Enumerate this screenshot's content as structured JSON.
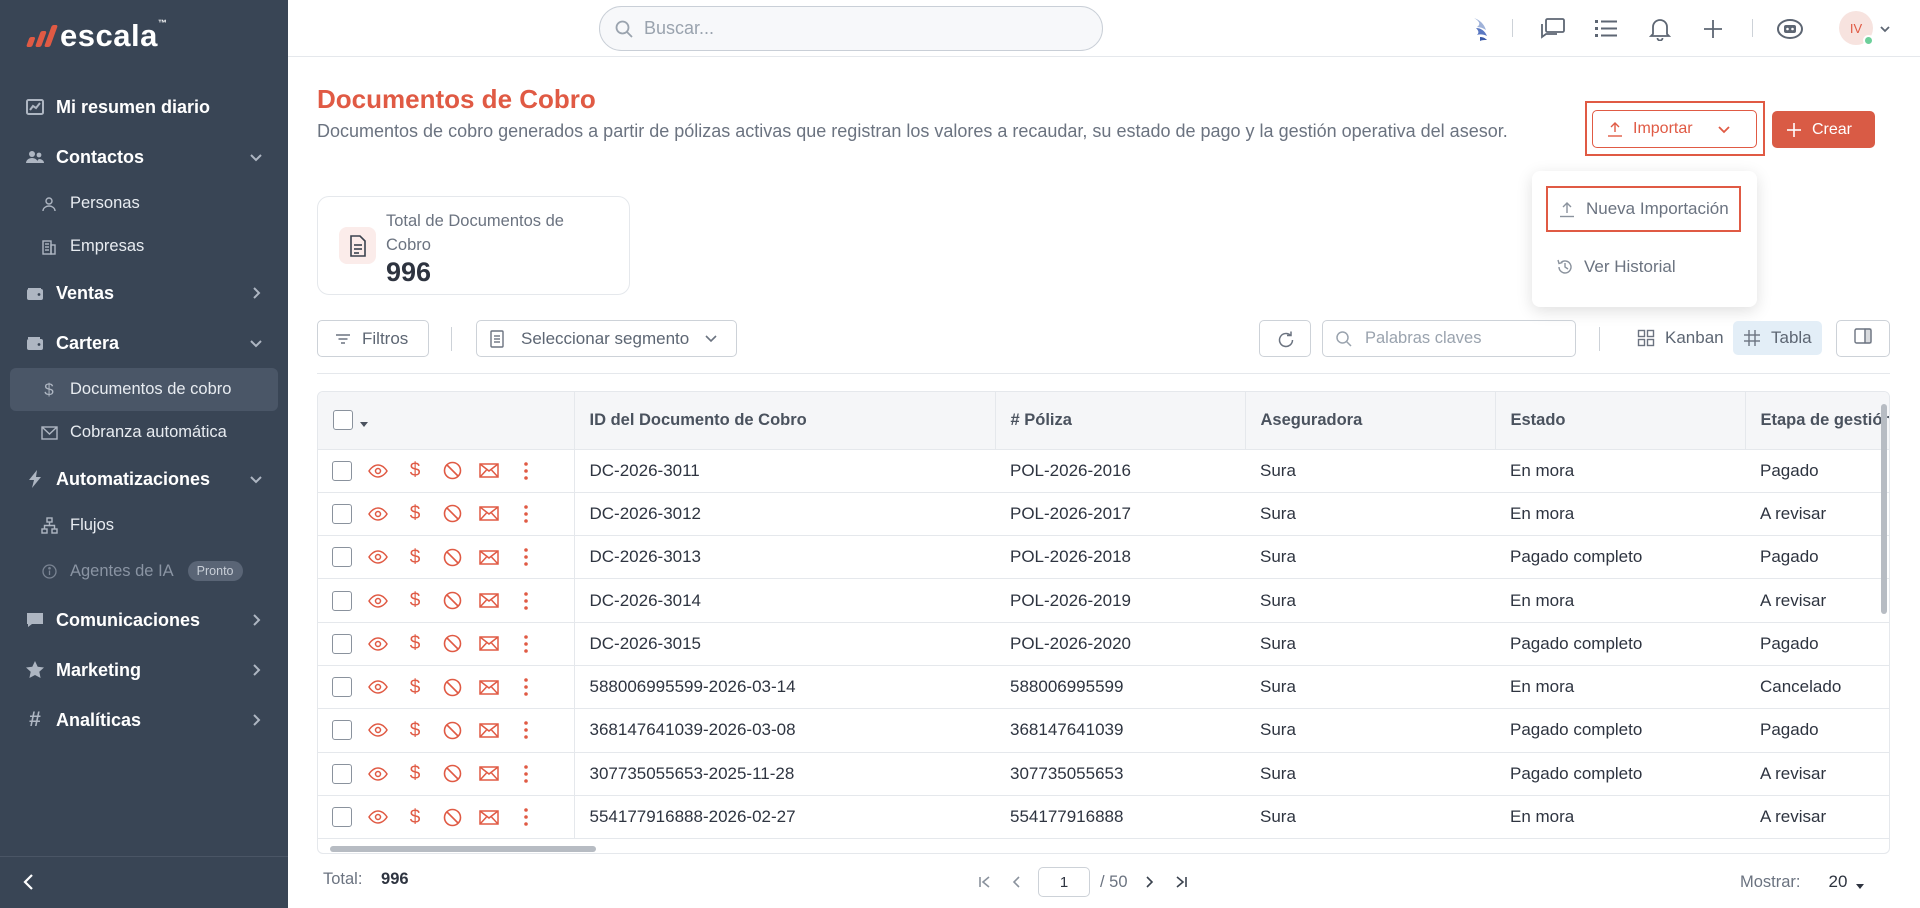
{
  "app": {
    "logo_text": "escala"
  },
  "sidebar": {
    "items": [
      {
        "label": "Mi resumen diario",
        "icon": "chart-icon"
      },
      {
        "label": "Contactos",
        "icon": "users-icon",
        "expanded": true,
        "children": [
          {
            "label": "Personas",
            "icon": "person-icon"
          },
          {
            "label": "Empresas",
            "icon": "building-icon"
          }
        ]
      },
      {
        "label": "Ventas",
        "icon": "wallet-icon",
        "expanded": false
      },
      {
        "label": "Cartera",
        "icon": "wallet-icon",
        "expanded": true,
        "children": [
          {
            "label": "Documentos de cobro",
            "icon": "dollar-icon",
            "active": true
          },
          {
            "label": "Cobranza automática",
            "icon": "mail-icon"
          }
        ]
      },
      {
        "label": "Automatizaciones",
        "icon": "bolt-icon",
        "expanded": true,
        "children": [
          {
            "label": "Flujos",
            "icon": "flow-icon"
          },
          {
            "label": "Agentes de IA",
            "icon": "info-icon",
            "badge": "Pronto",
            "disabled": true
          }
        ]
      },
      {
        "label": "Comunicaciones",
        "icon": "chat-icon",
        "expanded": false
      },
      {
        "label": "Marketing",
        "icon": "star-icon",
        "expanded": false
      },
      {
        "label": "Analíticas",
        "icon": "hash-icon",
        "expanded": false
      }
    ]
  },
  "topbar": {
    "search_placeholder": "Buscar...",
    "avatar_initials": "IV"
  },
  "page": {
    "title": "Documentos de Cobro",
    "description": "Documentos de cobro generados a partir de pólizas activas que registran los valores a recaudar, su estado de pago y la gestión operativa del asesor.",
    "import_label": "Importar",
    "create_label": "Crear",
    "dropdown": {
      "new_import": "Nueva Importación",
      "history": "Ver Historial"
    },
    "kpi": {
      "label": "Total de Documentos de Cobro",
      "value": "996"
    }
  },
  "toolbar": {
    "filters_label": "Filtros",
    "segment_label": "Seleccionar segmento",
    "keywords_placeholder": "Palabras claves",
    "kanban_label": "Kanban",
    "table_label": "Tabla",
    "active_view": "Tabla"
  },
  "table": {
    "columns": [
      "ID del Documento de Cobro",
      "# Póliza",
      "Aseguradora",
      "Estado",
      "Etapa de gestión"
    ],
    "rows": [
      [
        "DC-2026-3011",
        "POL-2026-2016",
        "Sura",
        "En mora",
        "Pagado"
      ],
      [
        "DC-2026-3012",
        "POL-2026-2017",
        "Sura",
        "En mora",
        "A revisar"
      ],
      [
        "DC-2026-3013",
        "POL-2026-2018",
        "Sura",
        "Pagado completo",
        "Pagado"
      ],
      [
        "DC-2026-3014",
        "POL-2026-2019",
        "Sura",
        "En mora",
        "A revisar"
      ],
      [
        "DC-2026-3015",
        "POL-2026-2020",
        "Sura",
        "Pagado completo",
        "Pagado"
      ],
      [
        "588006995599-2026-03-14",
        "588006995599",
        "Sura",
        "En mora",
        "Cancelado"
      ],
      [
        "368147641039-2026-03-08",
        "368147641039",
        "Sura",
        "Pagado completo",
        "Pagado"
      ],
      [
        "307735055653-2025-11-28",
        "307735055653",
        "Sura",
        "Pagado completo",
        "A revisar"
      ],
      [
        "554177916888-2026-02-27",
        "554177916888",
        "Sura",
        "En mora",
        "A revisar"
      ]
    ]
  },
  "footer": {
    "total_label": "Total:",
    "total_value": "996",
    "page_current": "1",
    "page_total": "/ 50",
    "show_label": "Mostrar:",
    "show_value": "20"
  },
  "colors": {
    "accent": "#e05a44",
    "sidebar_bg": "#394555",
    "create_btn": "#d95b45"
  }
}
